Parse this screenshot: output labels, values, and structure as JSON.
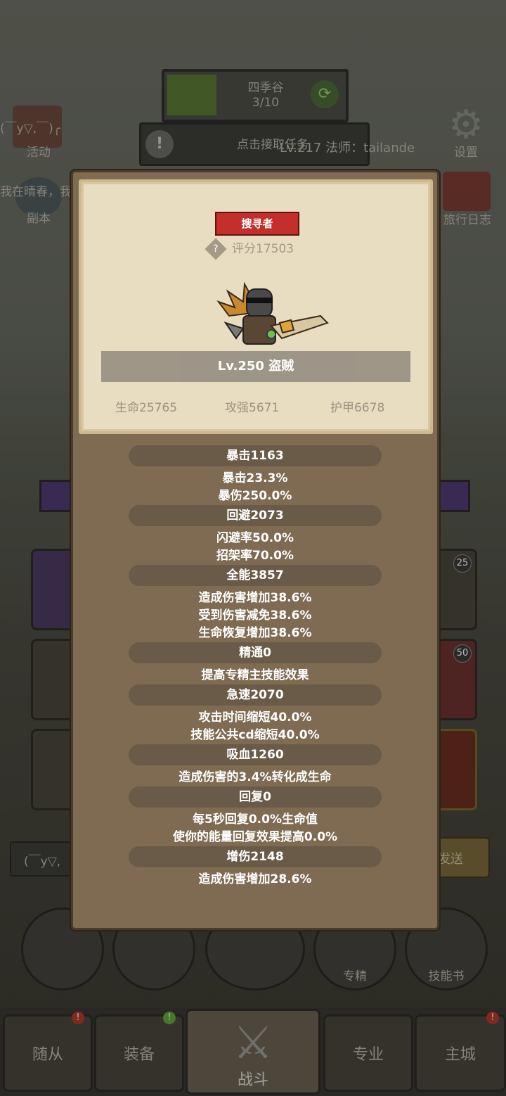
{
  "background": {
    "zone": {
      "name": "四季谷",
      "progress": "3/10"
    },
    "quest_button": "点击接取任务",
    "player_chat": "Lv.217 法师：tailande",
    "menu_left": [
      "活动",
      "副本"
    ],
    "menu_right": [
      "设置",
      "旅行日志"
    ],
    "chat_fragment_1": "(￣y▽,￣)╭",
    "chat_fragment_2": "我在晴春，我",
    "input_placeholder": "(￣y▽,",
    "send_button": "发送",
    "item_badges": [
      "25",
      "50"
    ],
    "bottom_shortcuts": [
      "专精",
      "技能书"
    ],
    "bottom_nav": [
      {
        "label": "随从",
        "badge": "!"
      },
      {
        "label": "装备",
        "badge": "!"
      },
      {
        "label": "战斗"
      },
      {
        "label": "专业"
      },
      {
        "label": "主城",
        "badge": "!"
      }
    ]
  },
  "character": {
    "role_tag": "搜寻者",
    "score_label": "评分17503",
    "level_class": "Lv.250 盗贼",
    "basic_stats": [
      "生命25765",
      "攻强5671",
      "护甲6678"
    ]
  },
  "stats": [
    {
      "title": "暴击1163",
      "lines": [
        "暴击23.3%",
        "暴伤250.0%"
      ]
    },
    {
      "title": "回避2073",
      "lines": [
        "闪避率50.0%",
        "招架率70.0%"
      ]
    },
    {
      "title": "全能3857",
      "lines": [
        "造成伤害增加38.6%",
        "受到伤害减免38.6%",
        "生命恢复增加38.6%"
      ]
    },
    {
      "title": "精通0",
      "lines": [
        "提高专精主技能效果"
      ]
    },
    {
      "title": "急速2070",
      "lines": [
        "攻击时间缩短40.0%",
        "技能公共cd缩短40.0%"
      ]
    },
    {
      "title": "吸血1260",
      "lines": [
        "造成伤害的3.4%转化成生命"
      ]
    },
    {
      "title": "回复0",
      "lines": [
        "每5秒回复0.0%生命值",
        "使你的能量回复效果提高0.0%"
      ]
    },
    {
      "title": "增伤2148",
      "lines": [
        "造成伤害增加28.6%"
      ]
    }
  ]
}
